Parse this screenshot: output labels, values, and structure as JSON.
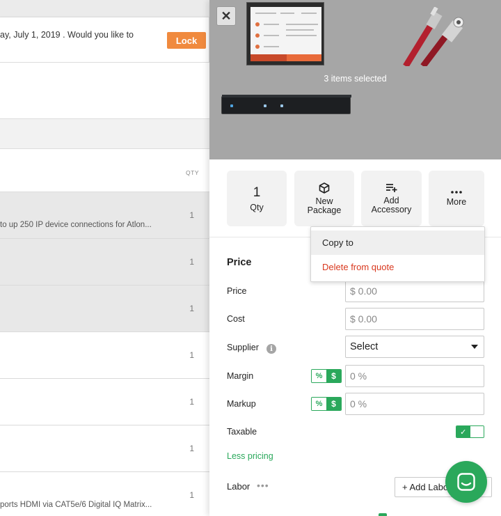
{
  "banner": {
    "text": "ay, July 1, 2019 . Would you like to",
    "lock_label": "Lock"
  },
  "table": {
    "qty_header": "QTY",
    "rows": [
      {
        "text": "to up 250 IP device connections for Atlon...",
        "qty": "1"
      },
      {
        "text": "",
        "qty": "1"
      },
      {
        "text": "",
        "qty": "1"
      },
      {
        "text": "",
        "qty": "1"
      },
      {
        "text": "",
        "qty": "1"
      },
      {
        "text": "",
        "qty": "1"
      },
      {
        "text": "ports HDMI via CAT5e/6 Digital IQ Matrix...",
        "qty": "1"
      }
    ]
  },
  "panel": {
    "close_label": "✕",
    "selected_text": "3 items selected",
    "actions": {
      "qty_value": "1",
      "qty_label": "Qty",
      "new_package_line1": "New",
      "new_package_line2": "Package",
      "add_accessory_line1": "Add",
      "add_accessory_line2": "Accessory",
      "more_label": "More"
    },
    "menu": {
      "copy_to": "Copy to",
      "delete": "Delete from quote"
    },
    "price": {
      "section_title": "Price",
      "price_label": "Price",
      "price_value": "$ 0.00",
      "cost_label": "Cost",
      "cost_value": "$ 0.00",
      "supplier_label": "Supplier",
      "supplier_value": "Select",
      "info_glyph": "i",
      "margin_label": "Margin",
      "margin_value": "0 %",
      "markup_label": "Markup",
      "markup_value": "0 %",
      "pct_glyph": "%",
      "dollar_glyph": "$",
      "taxable_label": "Taxable",
      "taxable_check": "✓",
      "less_pricing": "Less pricing"
    },
    "labor": {
      "label": "Labor",
      "more_dots": "•••",
      "add_label": "+ Add Labor"
    }
  },
  "colors": {
    "accent_green": "#2aa85b",
    "lock_orange": "#f08a3e",
    "delete_red": "#d9381e"
  },
  "icons": [
    "close-icon",
    "package-icon",
    "add-list-icon",
    "more-dots-icon",
    "info-icon",
    "check-icon",
    "chat-icon"
  ]
}
